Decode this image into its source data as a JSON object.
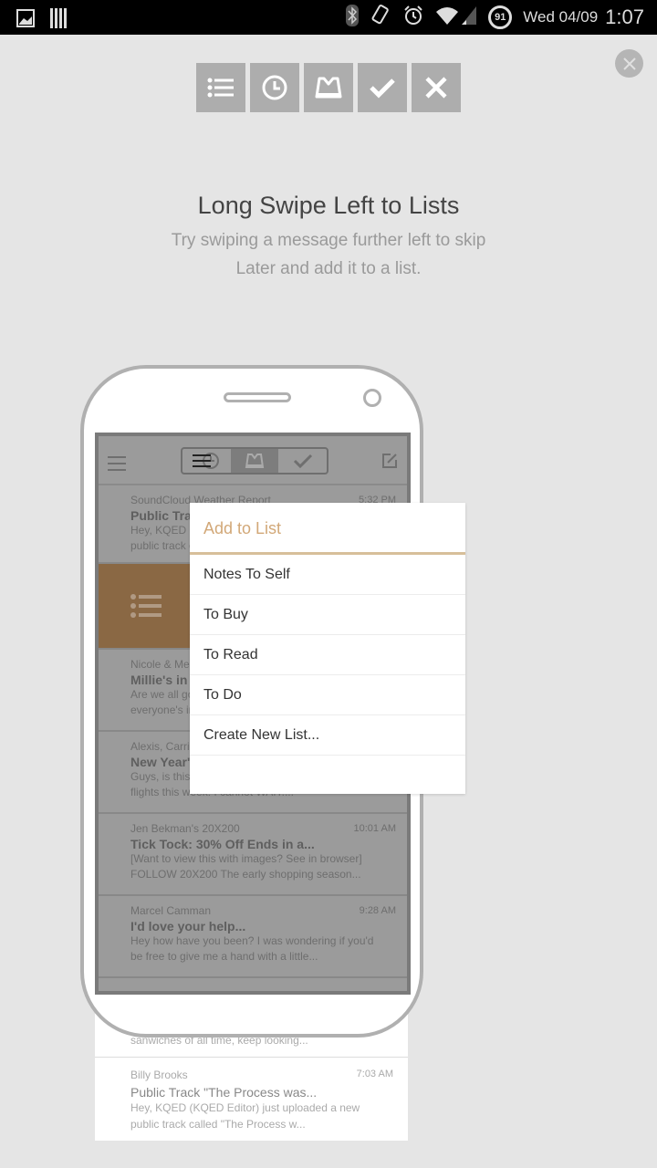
{
  "status_bar": {
    "left_icons": [
      "image-icon",
      "barcode-icon"
    ],
    "right_icons": [
      "bluetooth-icon",
      "rotate-icon",
      "alarm-icon",
      "wifi-icon",
      "signal-icon"
    ],
    "battery": "91",
    "date": "Wed 04/09",
    "time": "1:07"
  },
  "actions": [
    {
      "icon": "list-icon",
      "label": "Lists"
    },
    {
      "icon": "clock-icon",
      "label": "Later"
    },
    {
      "icon": "inbox-icon",
      "label": "Inbox"
    },
    {
      "icon": "check-icon",
      "label": "Archive"
    },
    {
      "icon": "x-icon",
      "label": "Delete"
    }
  ],
  "tutorial": {
    "title": "Long Swipe Left to Lists",
    "subtitle": "Try swiping a message further left to skip Later and add it to a list."
  },
  "phone": {
    "messages": [
      {
        "from": "SoundCloud Weather Report",
        "time": "5:32 PM",
        "subject": "Public Track",
        "preview1": "Hey, KQED (KQED Editor) just uploaded a new",
        "preview2": "public track called..."
      },
      {
        "from": "Nicole & Meghan",
        "time": "",
        "subject": "Millie's in Town",
        "preview1": "Are we all going out this weekend?",
        "preview2": "everyone's in..."
      },
      {
        "from": "Alexis, Carrie",
        "time": "",
        "subject": "New Year's Trip",
        "preview1": "Guys, is this really happening? I booked",
        "preview2": "flights this week! I cannot WAIT...."
      },
      {
        "from": "Jen Bekman's 20X200",
        "time": "10:01 AM",
        "subject": "Tick Tock: 30% Off Ends in a...",
        "preview1": "[Want to view this with images? See in browser]",
        "preview2": "FOLLOW 20X200 The early shopping season..."
      },
      {
        "from": "Marcel Camman",
        "time": "9:28 AM",
        "subject": "I'd love your help...",
        "preview1": "Hey how have you been? I was wondering if you'd",
        "preview2": "be free to give me a hand with a little..."
      }
    ],
    "below": {
      "partial_preview": "sanwiches of all time, keep looking...",
      "from": "Billy Brooks",
      "time": "7:03 AM",
      "subject": "Public Track \"The Process was...",
      "preview1": "Hey, KQED (KQED Editor) just uploaded a new",
      "preview2": "public track called \"The Process w..."
    }
  },
  "popup": {
    "title": "Add to List",
    "items": [
      "Notes To Self",
      "To Buy",
      "To Read",
      "To Do",
      "Create New List..."
    ]
  },
  "colors": {
    "accent": "#d2a878",
    "swipe": "#8a6844",
    "action_bg": "#adadad"
  }
}
